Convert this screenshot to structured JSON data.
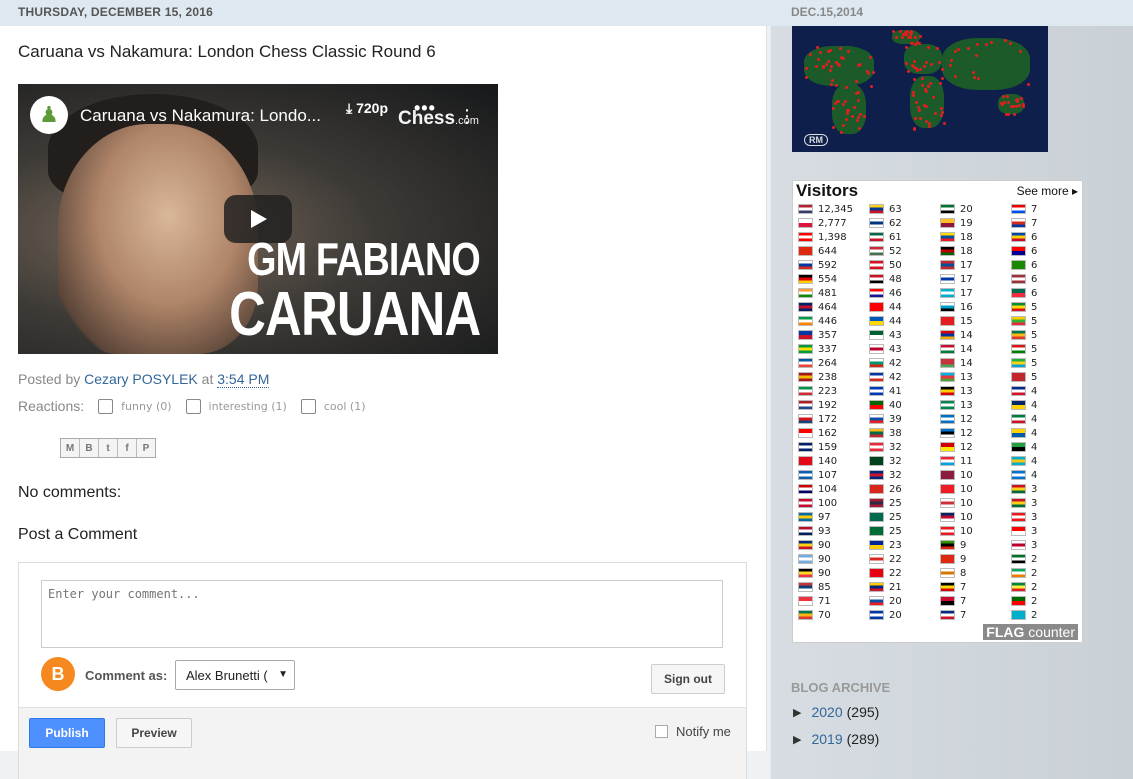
{
  "post": {
    "date_header": "THURSDAY, DECEMBER 15, 2016",
    "title": "Caruana vs Nakamura: London Chess Classic Round 6",
    "video": {
      "title": "Caruana vs Nakamura: Londo...",
      "download_label": "720p",
      "brand": "Chess",
      "brand_suffix": ".com",
      "caption_line1": "GM FABIANO",
      "caption_line2": "CARUANA"
    },
    "posted_by_label": "Posted by",
    "author": "Cezary POSYLEK",
    "at_label": "at",
    "time": "3:54 PM",
    "reactions_label": "Reactions:",
    "reactions": [
      {
        "label": "funny (0)"
      },
      {
        "label": "interesting (1)"
      },
      {
        "label": "cool (1)"
      }
    ],
    "share_icons": [
      "email-icon",
      "blogger-icon",
      "twitter-icon",
      "facebook-icon",
      "pinterest-icon"
    ],
    "no_comments": "No comments:",
    "post_comment_heading": "Post a Comment"
  },
  "comment_form": {
    "placeholder": "Enter your comment...",
    "comment_as_label": "Comment as:",
    "account": "Alex Brunetti (",
    "sign_out": "Sign out",
    "publish": "Publish",
    "preview": "Preview",
    "notify": "Notify me"
  },
  "sidebar": {
    "map_date": "DEC.15,2014",
    "map_badge": "RM",
    "flag_counter": {
      "title": "Visitors",
      "see_more": "See more",
      "logo_main": "FLAG",
      "logo_small": "counter",
      "columns": [
        [
          {
            "n": "12,345",
            "c": [
              "#b22234",
              "#fff",
              "#3c3b6e"
            ]
          },
          {
            "n": "2,777",
            "c": [
              "#fff",
              "#dc143c"
            ]
          },
          {
            "n": "1,398",
            "c": [
              "#ff0000",
              "#fff",
              "#ff0000"
            ]
          },
          {
            "n": "644",
            "c": [
              "#de2910"
            ]
          },
          {
            "n": "592",
            "c": [
              "#fff",
              "#0039a6",
              "#d52b1e"
            ]
          },
          {
            "n": "554",
            "c": [
              "#000",
              "#dd0000",
              "#ffce00"
            ]
          },
          {
            "n": "481",
            "c": [
              "#ff9933",
              "#fff",
              "#138808"
            ]
          },
          {
            "n": "464",
            "c": [
              "#012169",
              "#c8102e",
              "#012169"
            ]
          },
          {
            "n": "446",
            "c": [
              "#009a44",
              "#fff",
              "#ff8200"
            ]
          },
          {
            "n": "357",
            "c": [
              "#0038a8",
              "#ce1126"
            ]
          },
          {
            "n": "337",
            "c": [
              "#009c3b",
              "#ffdf00",
              "#009c3b"
            ]
          },
          {
            "n": "264",
            "c": [
              "#0055a4",
              "#fff",
              "#ef4135"
            ]
          },
          {
            "n": "238",
            "c": [
              "#aa151b",
              "#f1bf00",
              "#aa151b"
            ]
          },
          {
            "n": "223",
            "c": [
              "#009246",
              "#fff",
              "#ce2b37"
            ]
          },
          {
            "n": "192",
            "c": [
              "#ae1c28",
              "#fff",
              "#21468b"
            ]
          },
          {
            "n": "172",
            "c": [
              "#fff",
              "#d7141a",
              "#11457e"
            ]
          },
          {
            "n": "162",
            "c": [
              "#ff0000",
              "#fff"
            ]
          },
          {
            "n": "159",
            "c": [
              "#012169",
              "#fff",
              "#012169"
            ]
          },
          {
            "n": "140",
            "c": [
              "#e30a17"
            ]
          },
          {
            "n": "107",
            "c": [
              "#0d5eaf",
              "#fff",
              "#0d5eaf"
            ]
          },
          {
            "n": "104",
            "c": [
              "#cc0001",
              "#fff",
              "#010066"
            ]
          },
          {
            "n": "100",
            "c": [
              "#c60c30",
              "#fff",
              "#c60c30"
            ]
          },
          {
            "n": "97",
            "c": [
              "#006aa7",
              "#fecc00",
              "#006aa7"
            ]
          },
          {
            "n": "93",
            "c": [
              "#ba0c2f",
              "#fff",
              "#00205b"
            ]
          },
          {
            "n": "90",
            "c": [
              "#002b7f",
              "#fcd116",
              "#ce1126"
            ]
          },
          {
            "n": "90",
            "c": [
              "#74acdf",
              "#fff",
              "#74acdf"
            ]
          },
          {
            "n": "90",
            "c": [
              "#000",
              "#fdda24",
              "#ef3340"
            ]
          },
          {
            "n": "85",
            "c": [
              "#c6363c",
              "#0c4076",
              "#fff"
            ]
          },
          {
            "n": "71",
            "c": [
              "#ef3340",
              "#fff"
            ]
          },
          {
            "n": "70",
            "c": [
              "#007a4d",
              "#ffb612",
              "#de3831"
            ]
          }
        ],
        [
          {
            "n": "63",
            "c": [
              "#fcd116",
              "#003893",
              "#ce1126"
            ]
          },
          {
            "n": "62",
            "c": [
              "#fff",
              "#003580",
              "#fff"
            ]
          },
          {
            "n": "61",
            "c": [
              "#006847",
              "#fff",
              "#ce1126"
            ]
          },
          {
            "n": "52",
            "c": [
              "#ce2939",
              "#fff",
              "#477050"
            ]
          },
          {
            "n": "50",
            "c": [
              "#d91023",
              "#fff",
              "#d91023"
            ]
          },
          {
            "n": "48",
            "c": [
              "#ce1126",
              "#fff",
              "#000"
            ]
          },
          {
            "n": "46",
            "c": [
              "#ff0000",
              "#fff",
              "#171796"
            ]
          },
          {
            "n": "44",
            "c": [
              "#ff0000"
            ]
          },
          {
            "n": "44",
            "c": [
              "#0057b7",
              "#ffd700"
            ]
          },
          {
            "n": "43",
            "c": [
              "#006233",
              "#fff"
            ]
          },
          {
            "n": "43",
            "c": [
              "#fff",
              "#bc002d",
              "#fff"
            ]
          },
          {
            "n": "42",
            "c": [
              "#fff",
              "#00966e",
              "#d62612"
            ]
          },
          {
            "n": "42",
            "c": [
              "#0039a6",
              "#fff",
              "#d52b1e"
            ]
          },
          {
            "n": "41",
            "c": [
              "#0038b8",
              "#fff",
              "#0038b8"
            ]
          },
          {
            "n": "40",
            "c": [
              "#006600",
              "#ff0000"
            ]
          },
          {
            "n": "39",
            "c": [
              "#fff",
              "#0b4ea2",
              "#ee1c25"
            ]
          },
          {
            "n": "38",
            "c": [
              "#fdb913",
              "#006a44",
              "#c1272d"
            ]
          },
          {
            "n": "32",
            "c": [
              "#ed2939",
              "#fff",
              "#ed2939"
            ]
          },
          {
            "n": "32",
            "c": [
              "#01411c"
            ]
          },
          {
            "n": "32",
            "c": [
              "#00247d",
              "#cc142b",
              "#00247d"
            ]
          },
          {
            "n": "26",
            "c": [
              "#da251d"
            ]
          },
          {
            "n": "25",
            "c": [
              "#a51931",
              "#2d2a4a",
              "#a51931"
            ]
          },
          {
            "n": "25",
            "c": [
              "#006a4e"
            ]
          },
          {
            "n": "25",
            "c": [
              "#006c35"
            ]
          },
          {
            "n": "23",
            "c": [
              "#002395",
              "#fecb00"
            ]
          },
          {
            "n": "22",
            "c": [
              "#fff",
              "#da291c",
              "#fff"
            ]
          },
          {
            "n": "22",
            "c": [
              "#e70013"
            ]
          },
          {
            "n": "21",
            "c": [
              "#ffcc00",
              "#00247d",
              "#cf142b"
            ]
          },
          {
            "n": "20",
            "c": [
              "#fff",
              "#0b4ea2",
              "#ee1c25"
            ]
          },
          {
            "n": "20",
            "c": [
              "#0038a8",
              "#fff",
              "#0038a8"
            ]
          }
        ],
        [
          {
            "n": "20",
            "c": [
              "#00732f",
              "#fff",
              "#000"
            ]
          },
          {
            "n": "19",
            "c": [
              "#ffbe29",
              "#8d153a"
            ]
          },
          {
            "n": "18",
            "c": [
              "#ffdd00",
              "#034ea2",
              "#ed1c24"
            ]
          },
          {
            "n": "18",
            "c": [
              "#000",
              "#bb0000",
              "#006600"
            ]
          },
          {
            "n": "17",
            "c": [
              "#c4272f",
              "#015197",
              "#c4272f"
            ]
          },
          {
            "n": "17",
            "c": [
              "#fff",
              "#0038a8",
              "#fff"
            ]
          },
          {
            "n": "17",
            "c": [
              "#00afca",
              "#fff",
              "#00afca"
            ]
          },
          {
            "n": "16",
            "c": [
              "#fff",
              "#009fca",
              "#000"
            ]
          },
          {
            "n": "15",
            "c": [
              "#e41e20"
            ]
          },
          {
            "n": "14",
            "c": [
              "#d90012",
              "#0033a0",
              "#f2a800"
            ]
          },
          {
            "n": "14",
            "c": [
              "#c8102e",
              "#fff",
              "#007a3d"
            ]
          },
          {
            "n": "14",
            "c": [
              "#c8313e",
              "#c8313e",
              "#4aa657"
            ]
          },
          {
            "n": "13",
            "c": [
              "#00b5e2",
              "#ef3340",
              "#509e2f"
            ]
          },
          {
            "n": "13",
            "c": [
              "#000",
              "#ffce00",
              "#dd0000"
            ]
          },
          {
            "n": "13",
            "c": [
              "#008751",
              "#fff",
              "#008751"
            ]
          },
          {
            "n": "12",
            "c": [
              "#0072c6",
              "#fff",
              "#0072c6"
            ]
          },
          {
            "n": "12",
            "c": [
              "#0072ce",
              "#000",
              "#fff"
            ]
          },
          {
            "n": "12",
            "c": [
              "#d20000",
              "#ffe600"
            ]
          },
          {
            "n": "11",
            "c": [
              "#ed2939",
              "#fff",
              "#00a1de"
            ]
          },
          {
            "n": "10",
            "c": [
              "#8d1b3d"
            ]
          },
          {
            "n": "10",
            "c": [
              "#ee1c25"
            ]
          },
          {
            "n": "10",
            "c": [
              "#fff",
              "#cd2e3a",
              "#fff"
            ]
          },
          {
            "n": "10",
            "c": [
              "#002868",
              "#bf0a30",
              "#fff"
            ]
          },
          {
            "n": "10",
            "c": [
              "#ee161f",
              "#fff",
              "#ee161f"
            ]
          },
          {
            "n": "9",
            "c": [
              "#319208",
              "#000",
              "#de2010"
            ]
          },
          {
            "n": "9",
            "c": [
              "#de2910"
            ]
          },
          {
            "n": "8",
            "c": [
              "#fff",
              "#d57800",
              "#fff"
            ]
          },
          {
            "n": "7",
            "c": [
              "#000",
              "#fcdc04",
              "#d90000"
            ]
          },
          {
            "n": "7",
            "c": [
              "#cc092f",
              "#000"
            ]
          },
          {
            "n": "7",
            "c": [
              "#002b7f",
              "#fff",
              "#ce1126"
            ]
          }
        ],
        [
          {
            "n": "7",
            "c": [
              "#ed0000",
              "#fff",
              "#0050f0"
            ]
          },
          {
            "n": "7",
            "c": [
              "#fff",
              "#d52b1e",
              "#0039a6"
            ]
          },
          {
            "n": "6",
            "c": [
              "#0046ae",
              "#ffd200",
              "#cc092f"
            ]
          },
          {
            "n": "6",
            "c": [
              "#fe0000",
              "#000095"
            ]
          },
          {
            "n": "6",
            "c": [
              "#198a00"
            ]
          },
          {
            "n": "6",
            "c": [
              "#9e3039",
              "#fff",
              "#9e3039"
            ]
          },
          {
            "n": "6",
            "c": [
              "#006a4e",
              "#f42a41"
            ]
          },
          {
            "n": "5",
            "c": [
              "#078930",
              "#fcdd09",
              "#da121a"
            ]
          },
          {
            "n": "5",
            "c": [
              "#fecb00",
              "#34b233",
              "#ea2839"
            ]
          },
          {
            "n": "5",
            "c": [
              "#007749",
              "#ffb81c",
              "#de3831"
            ]
          },
          {
            "n": "5",
            "c": [
              "#db161b",
              "#fff",
              "#008000"
            ]
          },
          {
            "n": "5",
            "c": [
              "#1eb53a",
              "#fcd116",
              "#00a3dd"
            ]
          },
          {
            "n": "5",
            "c": [
              "#c1272d"
            ]
          },
          {
            "n": "4",
            "c": [
              "#002a8f",
              "#fff",
              "#cf142b"
            ]
          },
          {
            "n": "4",
            "c": [
              "#002868",
              "#ffd100"
            ]
          },
          {
            "n": "4",
            "c": [
              "#007a3d",
              "#fff",
              "#ce1126"
            ]
          },
          {
            "n": "4",
            "c": [
              "#ffd100",
              "#005daa"
            ]
          },
          {
            "n": "4",
            "c": [
              "#239f40",
              "#000"
            ]
          },
          {
            "n": "4",
            "c": [
              "#00afca",
              "#fec50c",
              "#00afca"
            ]
          },
          {
            "n": "4",
            "c": [
              "#0073cf",
              "#fff",
              "#0073cf"
            ]
          },
          {
            "n": "3",
            "c": [
              "#ce1126",
              "#fcd116",
              "#006b3f"
            ]
          },
          {
            "n": "3",
            "c": [
              "#ce1126",
              "#fcd116",
              "#006b3f"
            ]
          },
          {
            "n": "3",
            "c": [
              "#ee161f",
              "#fff",
              "#ee161f"
            ]
          },
          {
            "n": "3",
            "c": [
              "#ff0000",
              "#fff"
            ]
          },
          {
            "n": "3",
            "c": [
              "#fff",
              "#bc002d",
              "#fff"
            ]
          },
          {
            "n": "2",
            "c": [
              "#007229",
              "#fff",
              "#000"
            ]
          },
          {
            "n": "2",
            "c": [
              "#00a95c",
              "#fff",
              "#ef7d00"
            ]
          },
          {
            "n": "2",
            "c": [
              "#00853f",
              "#fdef42",
              "#e31b23"
            ]
          },
          {
            "n": "2",
            "c": [
              "#006600",
              "#ff0000"
            ]
          },
          {
            "n": "2",
            "c": [
              "#00afca"
            ]
          }
        ]
      ]
    },
    "archive_title": "BLOG ARCHIVE",
    "archive": [
      {
        "year": "2020",
        "count": "(295)"
      },
      {
        "year": "2019",
        "count": "(289)"
      }
    ]
  }
}
